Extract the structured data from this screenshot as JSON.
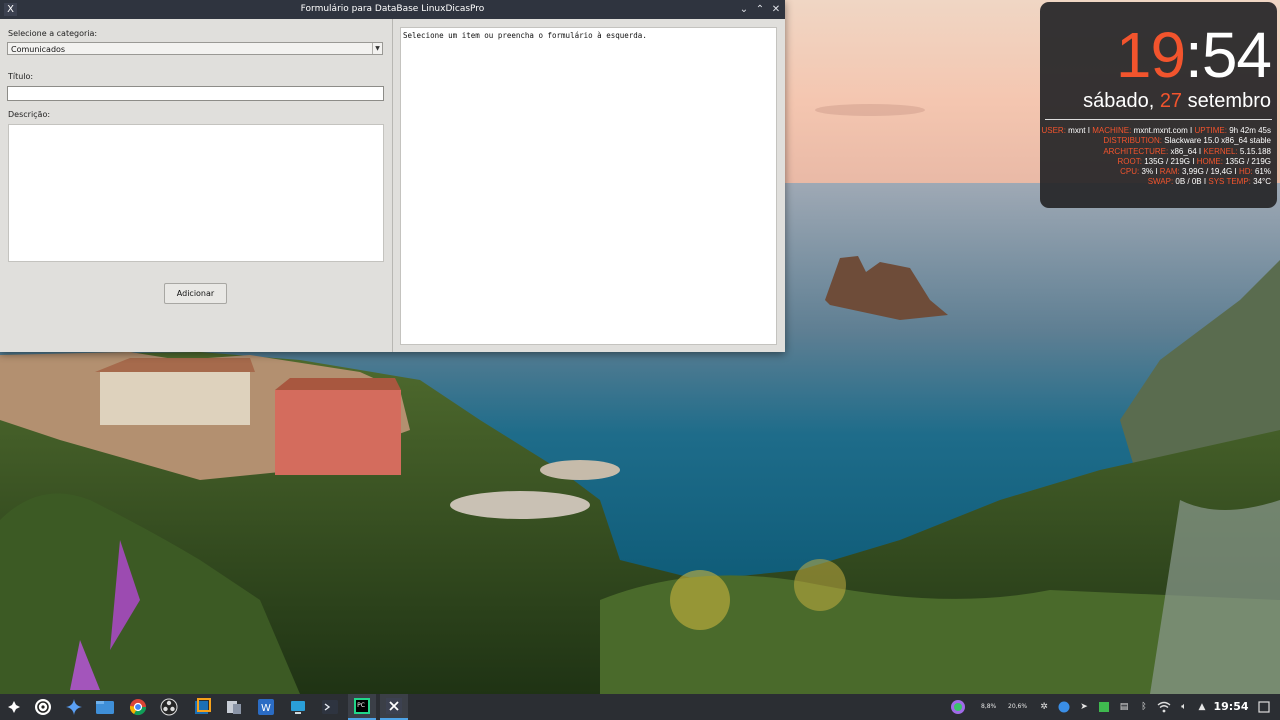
{
  "window": {
    "title": "Formulário para DataBase LinuxDicasPro",
    "minimize_glyph": "⌄",
    "maximize_glyph": "⌃",
    "close_glyph": "✕",
    "icon_glyph": "X"
  },
  "form": {
    "category_label": "Selecione a categoria:",
    "category_value": "Comunicados",
    "title_label": "Título:",
    "title_value": "",
    "description_label": "Descrição:",
    "description_value": "",
    "add_button": "Adicionar"
  },
  "output": {
    "text": "Selecione um item ou preencha o formulário à esquerda."
  },
  "conky": {
    "hour": "19",
    "colon": ":",
    "minute": "54",
    "weekday": "sábado,",
    "day": "27",
    "month": "setembro",
    "stats": {
      "user_key": "USER:",
      "user_val": "mxnt",
      "machine_key": "MACHINE:",
      "machine_val": "mxnt.mxnt.com",
      "uptime_key": "UPTIME:",
      "uptime_val": "9h 42m 45s",
      "distro_key": "DISTRIBUTION:",
      "distro_val": "Slackware 15.0 x86_64 stable",
      "arch_key": "ARCHITECTURE:",
      "arch_val": "x86_64",
      "kernel_key": "KERNEL:",
      "kernel_val": "5.15.188",
      "root_key": "ROOT:",
      "root_val": "135G / 219G",
      "home_key": "HOME:",
      "home_val": "135G / 219G",
      "cpu_key": "CPU:",
      "cpu_val": "3%",
      "ram_key": "RAM:",
      "ram_val": "3,99G / 19,4G",
      "hd_key": "HD:",
      "hd_val": "61%",
      "swap_key": "SWAP:",
      "swap_val": "0B / 0B",
      "systemp_key": "SYS TEMP:",
      "systemp_val": "34°C",
      "sep": "I"
    },
    "accent_color": "#f2542d"
  },
  "taskbar": {
    "apps": [
      "launcher-icon",
      "openai-icon",
      "gemini-icon",
      "file-manager-icon",
      "chrome-icon",
      "obs-icon",
      "virtualbox-icon",
      "settings-manager-icon",
      "word-editor-icon",
      "screen-icon",
      "terminal-icon",
      "pycharm-icon",
      "x-app-icon"
    ],
    "tray": {
      "cpu_label": "8,8%",
      "mem_label": "20,6%"
    },
    "clock": "19:54"
  }
}
